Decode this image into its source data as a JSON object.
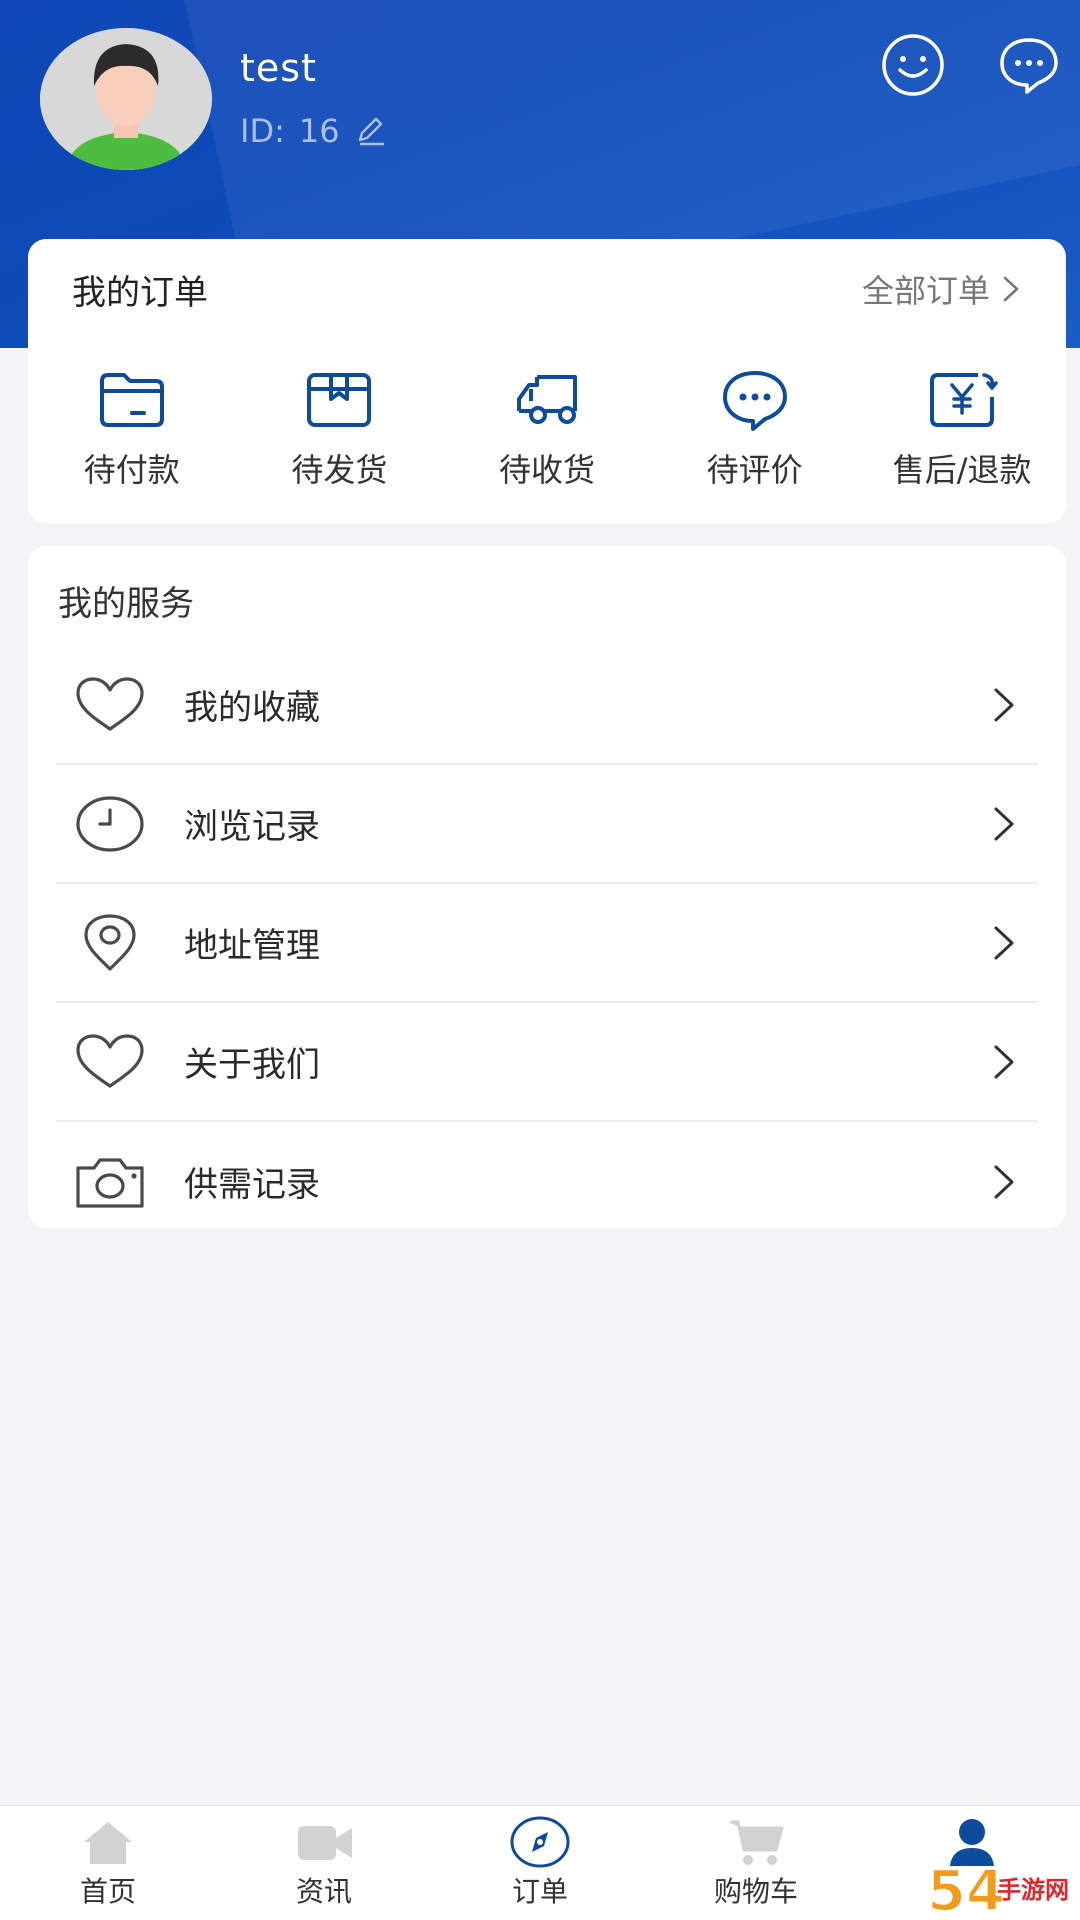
{
  "colors": {
    "brand_blue": "#0d4ab8",
    "icon_blue": "#0d4b9c",
    "header_text": "#ffffff",
    "id_text": "#a9c0ee",
    "background": "#f4f4f6"
  },
  "profile": {
    "username": "test",
    "id_label": "ID: ",
    "id_value": "16"
  },
  "orders": {
    "title": "我的订单",
    "all_label": "全部订单",
    "items": [
      {
        "label": "待付款",
        "icon": "wallet-icon"
      },
      {
        "label": "待发货",
        "icon": "box-icon"
      },
      {
        "label": "待收货",
        "icon": "truck-icon"
      },
      {
        "label": "待评价",
        "icon": "comment-icon"
      },
      {
        "label": "售后/退款",
        "icon": "refund-icon"
      }
    ]
  },
  "services": {
    "title": "我的服务",
    "items": [
      {
        "label": "我的收藏",
        "icon": "heart-icon"
      },
      {
        "label": "浏览记录",
        "icon": "clock-icon"
      },
      {
        "label": "地址管理",
        "icon": "location-pin-icon"
      },
      {
        "label": "关于我们",
        "icon": "heart-icon"
      },
      {
        "label": "供需记录",
        "icon": "camera-icon"
      }
    ]
  },
  "tabbar": {
    "items": [
      {
        "label": "首页",
        "icon": "home-icon",
        "active": false
      },
      {
        "label": "资讯",
        "icon": "video-icon",
        "active": false
      },
      {
        "label": "订单",
        "icon": "compass-icon",
        "active": false
      },
      {
        "label": "购物车",
        "icon": "cart-icon",
        "active": false
      },
      {
        "label": "",
        "icon": "user-icon",
        "active": true
      }
    ]
  },
  "watermark": {
    "text": "54手游网"
  }
}
